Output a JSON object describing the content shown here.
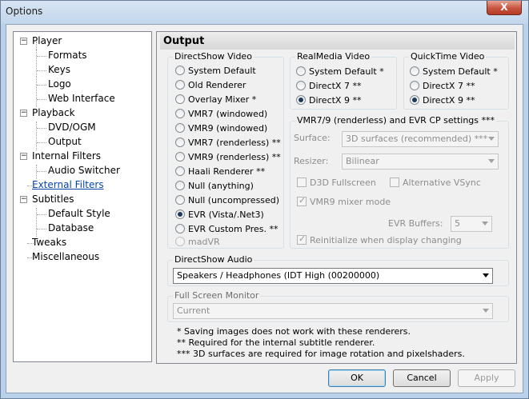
{
  "window": {
    "title": "Options",
    "close_label": "X"
  },
  "tree": {
    "items": [
      {
        "label": "Player"
      },
      {
        "label": "Formats"
      },
      {
        "label": "Keys"
      },
      {
        "label": "Logo"
      },
      {
        "label": "Web Interface"
      },
      {
        "label": "Playback"
      },
      {
        "label": "DVD/OGM"
      },
      {
        "label": "Output"
      },
      {
        "label": "Internal Filters"
      },
      {
        "label": "Audio Switcher"
      },
      {
        "label": "External Filters"
      },
      {
        "label": "Subtitles"
      },
      {
        "label": "Default Style"
      },
      {
        "label": "Database"
      },
      {
        "label": "Tweaks"
      },
      {
        "label": "Miscellaneous"
      }
    ],
    "collapse_glyph": "−"
  },
  "panel": {
    "title": "Output"
  },
  "directshow_video": {
    "label": "DirectShow Video",
    "options": [
      {
        "label": "System Default",
        "checked": false,
        "disabled": false
      },
      {
        "label": "Old Renderer",
        "checked": false,
        "disabled": false
      },
      {
        "label": "Overlay Mixer *",
        "checked": false,
        "disabled": false
      },
      {
        "label": "VMR7 (windowed)",
        "checked": false,
        "disabled": false
      },
      {
        "label": "VMR9 (windowed)",
        "checked": false,
        "disabled": false
      },
      {
        "label": "VMR7 (renderless) **",
        "checked": false,
        "disabled": false
      },
      {
        "label": "VMR9 (renderless) **",
        "checked": false,
        "disabled": false
      },
      {
        "label": "Haali Renderer **",
        "checked": false,
        "disabled": false
      },
      {
        "label": "Null (anything)",
        "checked": false,
        "disabled": false
      },
      {
        "label": "Null (uncompressed)",
        "checked": false,
        "disabled": false
      },
      {
        "label": "EVR (Vista/.Net3)",
        "checked": true,
        "disabled": false
      },
      {
        "label": "EVR Custom Pres. **",
        "checked": false,
        "disabled": false
      },
      {
        "label": "madVR",
        "checked": false,
        "disabled": true
      }
    ]
  },
  "realmedia_video": {
    "label": "RealMedia Video",
    "options": [
      {
        "label": "System Default *",
        "checked": false
      },
      {
        "label": "DirectX 7 **",
        "checked": false
      },
      {
        "label": "DirectX 9 **",
        "checked": true
      }
    ]
  },
  "quicktime_video": {
    "label": "QuickTime Video",
    "options": [
      {
        "label": "System Default *",
        "checked": false
      },
      {
        "label": "DirectX 7 **",
        "checked": false
      },
      {
        "label": "DirectX 9 **",
        "checked": true
      }
    ]
  },
  "vmr_settings": {
    "label": "VMR7/9 (renderless) and EVR CP settings ***",
    "surface_label": "Surface:",
    "surface_value": "3D surfaces (recommended) ***",
    "resizer_label": "Resizer:",
    "resizer_value": "Bilinear",
    "d3d_fullscreen": "D3D Fullscreen",
    "alt_vsync": "Alternative VSync",
    "vmr9_mixer": "VMR9 mixer mode",
    "evr_buffers_label": "EVR Buffers:",
    "evr_buffers_value": "5",
    "reinitialize": "Reinitialize when display changing"
  },
  "directshow_audio": {
    "label": "DirectShow Audio",
    "value": "Speakers / Headphones (IDT High (00200000)"
  },
  "fullscreen_monitor": {
    "label": "Full Screen Monitor",
    "value": "Current"
  },
  "notes": [
    "* Saving images does not work with these renderers.",
    "** Required for the internal subtitle renderer.",
    "*** 3D surfaces are required for image rotation and pixelshaders."
  ],
  "buttons": {
    "ok": "OK",
    "cancel": "Cancel",
    "apply": "Apply"
  },
  "colors": {
    "accent": "#3c7fb1",
    "titlebar": "#c2d6ec",
    "link": "#0645ad",
    "close": "#c7533e"
  }
}
